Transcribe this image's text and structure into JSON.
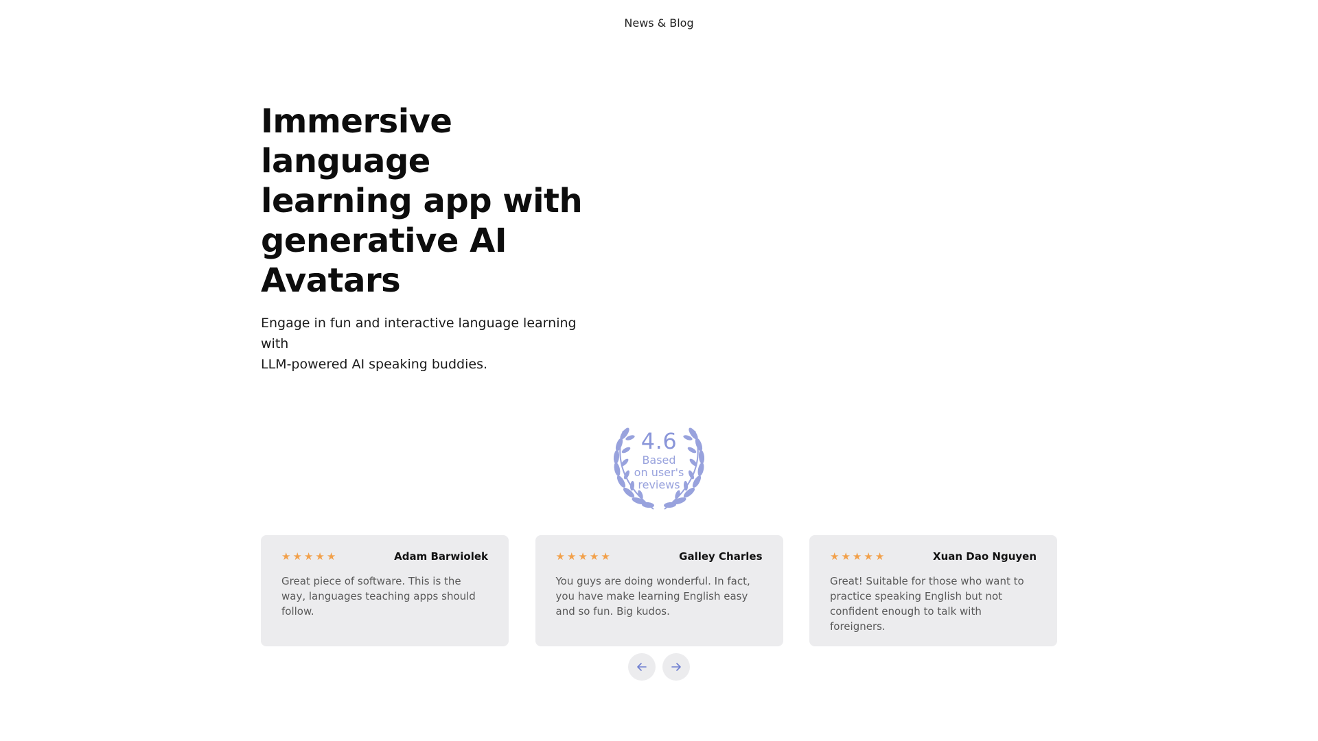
{
  "nav": {
    "news_blog": "News & Blog"
  },
  "hero": {
    "title_lines": [
      "Immersive language",
      "learning app with",
      "generative AI Avatars"
    ],
    "subtitle_lines": [
      "Engage in fun and interactive language learning with",
      "LLM-powered AI speaking buddies."
    ]
  },
  "rating": {
    "value": "4.6",
    "caption_lines": [
      "Based",
      "on user's",
      "reviews"
    ],
    "color": "#8a96d9"
  },
  "reviews": [
    {
      "stars": 5,
      "name": "Adam Barwiolek",
      "text": "Great piece of software. This is the way, languages teaching apps should follow."
    },
    {
      "stars": 5,
      "name": "Galley Charles",
      "text": "You guys are doing wonderful. In fact, you have make learning English easy and so fun. Big kudos."
    },
    {
      "stars": 5,
      "name": "Xuan Dao Nguyen",
      "text": "Great! Suitable for those who want to practice speaking English but not confident enough to talk with foreigners."
    }
  ],
  "pager": {
    "prev_icon": "arrow-left-icon",
    "next_icon": "arrow-right-icon"
  },
  "colors": {
    "star": "#f2a04a",
    "card_bg": "#ececee",
    "accent": "#8a96d9"
  }
}
